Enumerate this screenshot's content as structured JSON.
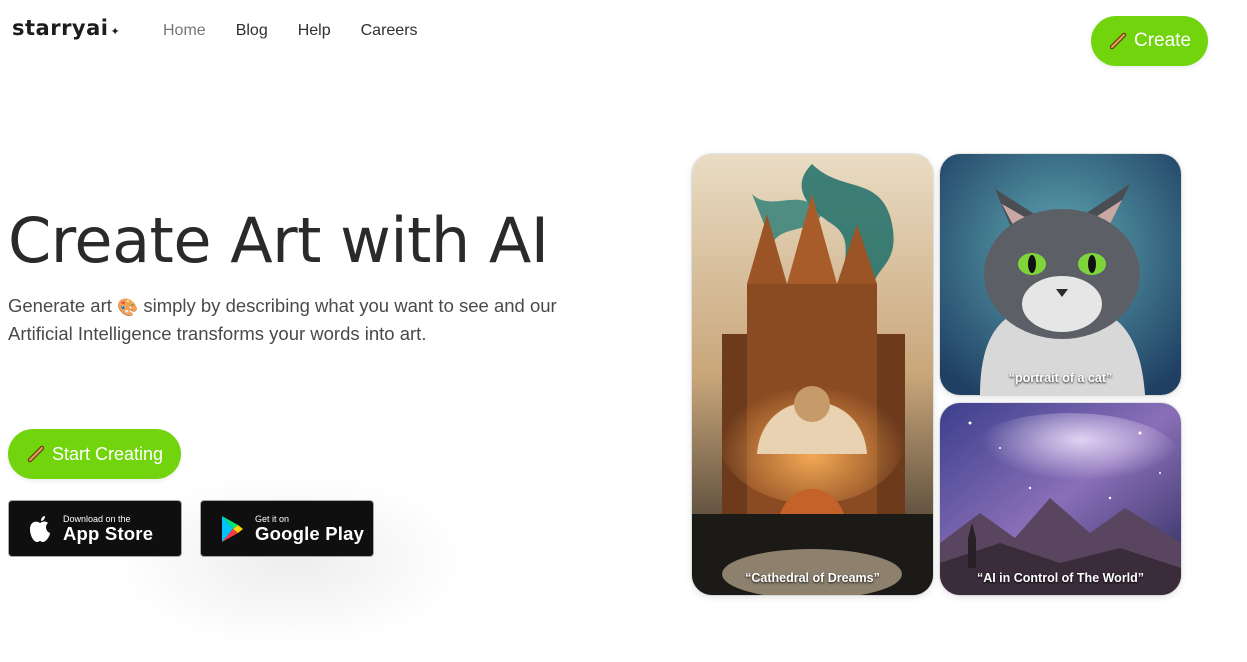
{
  "header": {
    "logo": "starryai",
    "logo_mark": "✦",
    "nav": [
      "Home",
      "Blog",
      "Help",
      "Careers"
    ],
    "create_label": "Create"
  },
  "hero": {
    "title": "Create Art with AI",
    "subtitle_before": "Generate art",
    "subtitle_emoji": "🎨",
    "subtitle_after": "simply by describing what you want to see and our Artificial Intelligence transforms your words into art.",
    "start_label": "Start Creating"
  },
  "stores": {
    "apple": {
      "small": "Download on the",
      "big": "App Store",
      "icon": "apple-icon"
    },
    "google": {
      "small": "Get it on",
      "big": "Google Play",
      "icon": "google-play-icon"
    }
  },
  "gallery": [
    {
      "caption": "“Cathedral of Dreams”"
    },
    {
      "caption": "“portrait of a cat”"
    },
    {
      "caption": "“AI in Control of The World”"
    }
  ],
  "colors": {
    "accent": "#72d40d",
    "store_bg": "#0f0f0f",
    "text": "#2a2a2a"
  }
}
